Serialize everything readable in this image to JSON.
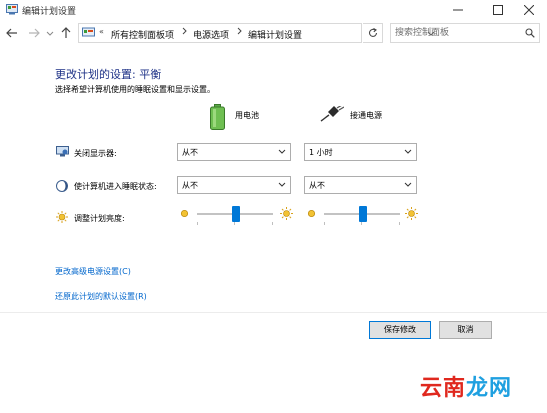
{
  "window": {
    "title": "编辑计划设置"
  },
  "addressbar": {
    "overflow": "«",
    "crumbs": [
      "所有控制面板项",
      "电源选项",
      "编辑计划设置"
    ]
  },
  "search": {
    "placeholder": "搜索控制面板"
  },
  "main": {
    "heading": "更改计划的设置: 平衡",
    "subheading": "选择希望计算机使用的睡眠设置和显示设置。",
    "columns": {
      "battery": "用电池",
      "plugged": "接通电源"
    },
    "rows": {
      "display": {
        "label": "关闭显示器:",
        "battery": "从不",
        "plugged": "1 小时"
      },
      "sleep": {
        "label": "使计算机进入睡眠状态:",
        "battery": "从不",
        "plugged": "从不"
      },
      "brightness": {
        "label": "调整计划亮度:",
        "battery_level": 0.52,
        "plugged_level": 0.52
      }
    },
    "links": {
      "advanced": "更改高级电源设置(C)",
      "restore": "还原此计划的默认设置(R)"
    }
  },
  "buttons": {
    "save": "保存修改",
    "cancel": "取消"
  },
  "watermark": {
    "part1": "云南",
    "part2": "龙网"
  },
  "colors": {
    "heading": "#1e3287",
    "link": "#0066cc",
    "accent": "#0078d7",
    "watermark_red": "#e0281e",
    "watermark_blue": "#1fa0e0"
  }
}
